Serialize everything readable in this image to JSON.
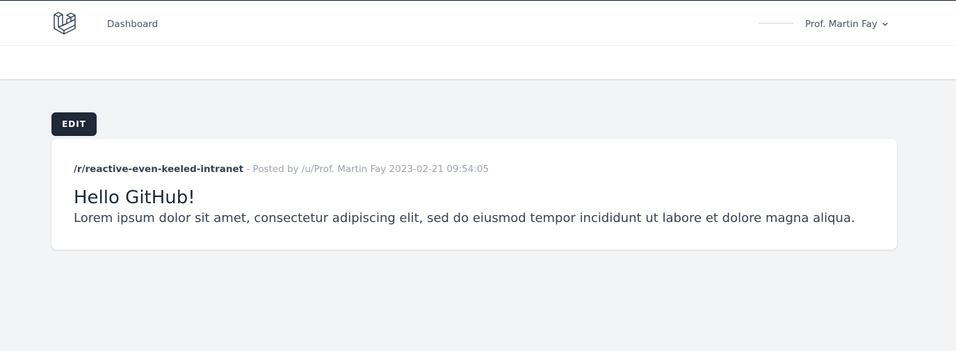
{
  "nav": {
    "logo_icon": "laravel-logo-icon",
    "dashboard_label": "Dashboard",
    "user_name": "Prof. Martin Fay",
    "user_menu_icon": "chevron-down-icon"
  },
  "actions": {
    "edit_label": "EDIT"
  },
  "post": {
    "subreddit": "/r/reactive-even-keeled-intranet",
    "posted_by": " - Posted by /u/Prof. Martin Fay 2023-02-21 09:54:05",
    "title": "Hello GitHub!",
    "body": "Lorem ipsum dolor sit amet, consectetur adipiscing elit, sed do eiusmod tempor incididunt ut labore et dolore magna aliqua."
  },
  "colors": {
    "page_background": "#f3f4f6",
    "button_background": "#1f2937",
    "muted_text": "#9ca3af"
  }
}
